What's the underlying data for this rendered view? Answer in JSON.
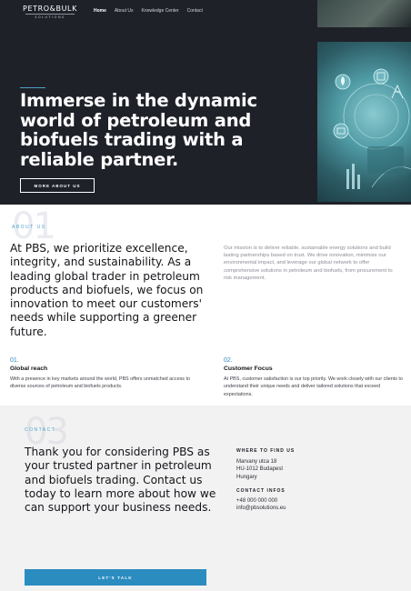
{
  "brand": {
    "logo_main": "PETRO&BULK",
    "logo_sub": "SOLUTIONS"
  },
  "nav": {
    "items": [
      "Home",
      "About Us",
      "Knowledge Center",
      "Contact"
    ],
    "active": "Home"
  },
  "hero": {
    "title": "Immerse in the dynamic world of petroleum and biofuels trading with a reliable partner.",
    "button_label": "MORE ABOUT US"
  },
  "about": {
    "number": "01",
    "eyebrow": "ABOUT US",
    "lead": "At PBS, we prioritize excellence, integrity, and sustainability. As a leading global trader in petroleum products and biofuels, we focus on innovation to meet our customers' needs while supporting a greener future.",
    "mission": "Our mission is to deliver reliable, sustainable energy solutions and build lasting partnerships based on trust. We drive innovation, minimize our environmental impact, and leverage our global network to offer comprehensive solutions in petroleum and biofuels, from procurement to risk management."
  },
  "features": [
    {
      "number": "01.",
      "title": "Global reach",
      "text": "With a presence in key markets around the world, PBS offers unmatched access to diverse sources of petroleum and biofuels products."
    },
    {
      "number": "02.",
      "title": "Customer Focus",
      "text": "At PBS, customer satisfaction is our top priority. We work closely with our clients to understand their unique needs and deliver tailored solutions that exceed expectations."
    }
  ],
  "contact": {
    "number": "03",
    "eyebrow": "CONTACT",
    "lead": "Thank you for considering PBS as your trusted partner in petroleum and biofuels trading. Contact us today to learn more about how we can support your business needs.",
    "where_heading": "WHERE TO FIND US",
    "address": [
      "Marvany utca 18",
      "HU-1012 Budapest",
      "Hungary"
    ],
    "infos_heading": "CONTACT INFOS",
    "phone": "+48 000 000 000",
    "email": "info@pbsolutions.eu",
    "button_label": "LET'S TALK"
  },
  "colors": {
    "hero_bg": "#1f2129",
    "accent": "#2b8cc0",
    "contact_bg": "#f2f2f3"
  }
}
